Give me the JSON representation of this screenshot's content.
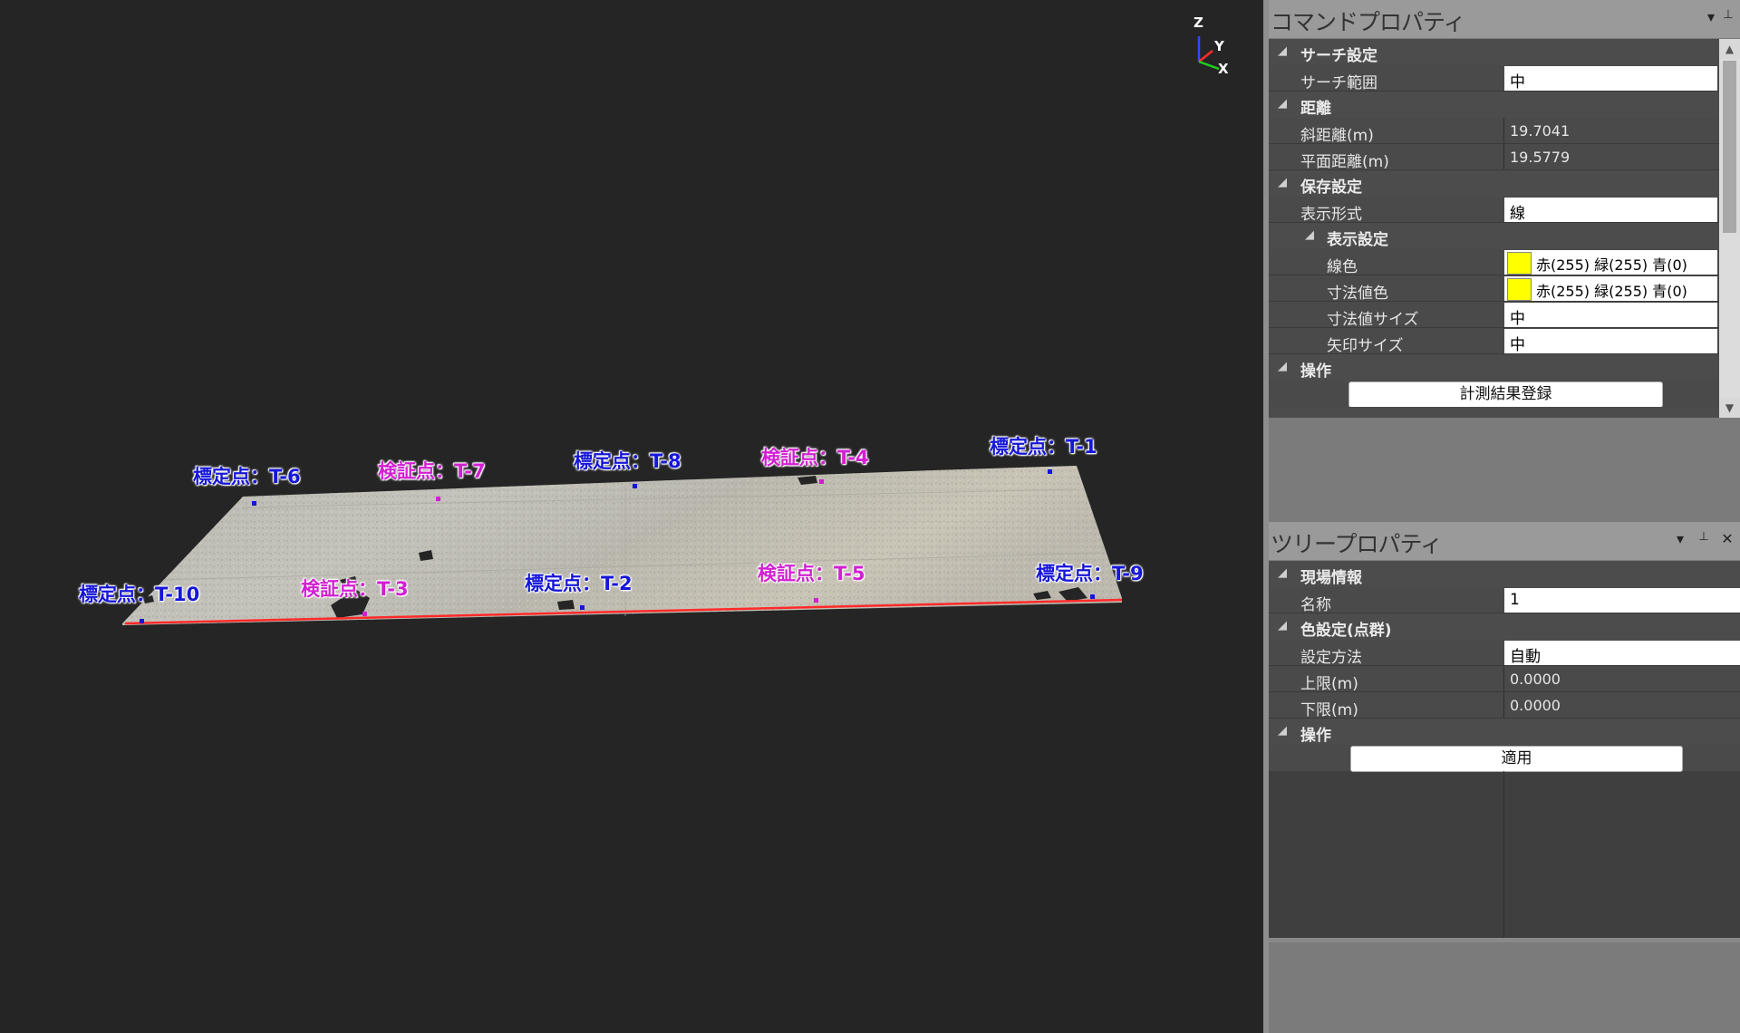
{
  "viewport": {
    "axis": {
      "z": "Z",
      "y": "Y",
      "x": "X"
    },
    "labels": [
      {
        "text": "標定点：T-6",
        "type": "calib"
      },
      {
        "text": "検証点：T-7",
        "type": "verify"
      },
      {
        "text": "標定点：T-8",
        "type": "calib"
      },
      {
        "text": "検証点：T-4",
        "type": "verify"
      },
      {
        "text": "標定点：T-1",
        "type": "calib"
      },
      {
        "text": "標定点：T-10",
        "type": "calib"
      },
      {
        "text": "検証点：T-3",
        "type": "verify"
      },
      {
        "text": "標定点：T-2",
        "type": "calib"
      },
      {
        "text": "検証点：T-5",
        "type": "verify"
      },
      {
        "text": "標定点：T-9",
        "type": "calib"
      }
    ],
    "colors": {
      "calib": "#1616d8",
      "verify": "#d21fd2",
      "measure_line": "#ff2a2a"
    }
  },
  "command_panel": {
    "title": "コマンドプロパティ",
    "icons": {
      "dropdown": "chevron-down-icon",
      "pin": "pin-icon"
    },
    "search": {
      "category": "サーチ設定",
      "range_label": "サーチ範囲",
      "range_value": "中"
    },
    "distance": {
      "category": "距離",
      "slope_label": "斜距離(m)",
      "slope_value": "19.7041",
      "plane_label": "平面距離(m)",
      "plane_value": "19.5779"
    },
    "save": {
      "category": "保存設定",
      "format_label": "表示形式",
      "format_value": "線",
      "display": {
        "category": "表示設定",
        "line_color_label": "線色",
        "line_color_value": "赤(255) 緑(255) 青(0)",
        "dim_color_label": "寸法値色",
        "dim_color_value": "赤(255) 緑(255) 青(0)",
        "dim_size_label": "寸法値サイズ",
        "dim_size_value": "中",
        "arrow_size_label": "矢印サイズ",
        "arrow_size_value": "中"
      }
    },
    "operation": {
      "category": "操作",
      "register_button": "計測結果登録"
    },
    "swatch_color": "#ffff00"
  },
  "tree_panel": {
    "title": "ツリープロパティ",
    "icons": {
      "dropdown": "chevron-down-icon",
      "pin": "pin-icon",
      "close": "close-icon"
    },
    "site": {
      "category": "現場情報",
      "name_label": "名称",
      "name_value": "1"
    },
    "color": {
      "category": "色設定(点群)",
      "method_label": "設定方法",
      "method_value": "自動",
      "upper_label": "上限(m)",
      "upper_value": "0.0000",
      "lower_label": "下限(m)",
      "lower_value": "0.0000"
    },
    "operation": {
      "category": "操作",
      "apply_button": "適用"
    }
  }
}
